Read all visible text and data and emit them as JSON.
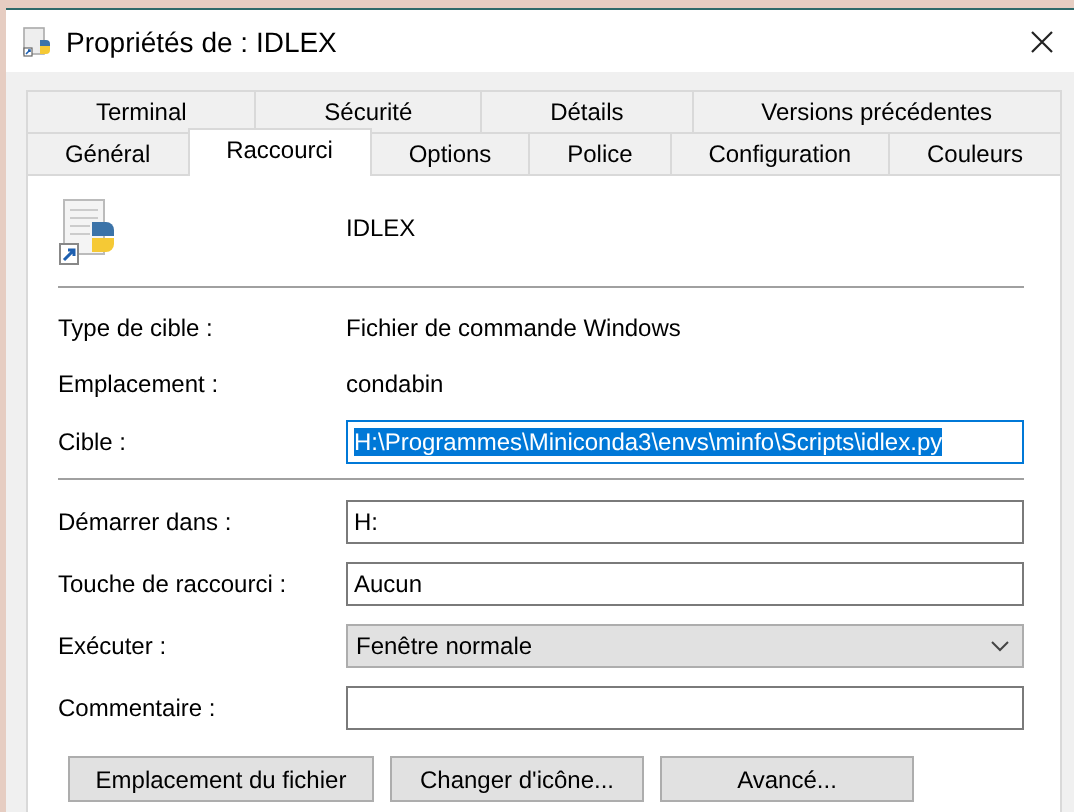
{
  "window": {
    "title": "Propriétés de : IDLEX"
  },
  "tab_rows": [
    [
      {
        "label": "Terminal",
        "selected": false
      },
      {
        "label": "Sécurité",
        "selected": false
      },
      {
        "label": "Détails",
        "selected": false
      },
      {
        "label": "Versions précédentes",
        "selected": false
      }
    ],
    [
      {
        "label": "Général",
        "selected": false
      },
      {
        "label": "Raccourci",
        "selected": true
      },
      {
        "label": "Options",
        "selected": false
      },
      {
        "label": "Police",
        "selected": false
      },
      {
        "label": "Configuration",
        "selected": false
      },
      {
        "label": "Couleurs",
        "selected": false
      }
    ]
  ],
  "shortcut_name": "IDLEX",
  "info": [
    {
      "label": "Type de cible :",
      "value": "Fichier de commande Windows"
    },
    {
      "label": "Emplacement :",
      "value": "condabin"
    }
  ],
  "target": {
    "label": "Cible :",
    "value": "H:\\Programmes\\Miniconda3\\envs\\minfo\\Scripts\\idlex.py",
    "text_selected": true
  },
  "fields": [
    {
      "kind": "text",
      "label": "Démarrer dans :",
      "value": "H:"
    },
    {
      "kind": "text",
      "label": "Touche de raccourci :",
      "value": "Aucun"
    },
    {
      "kind": "select",
      "label": "Exécuter :",
      "value": "Fenêtre normale"
    },
    {
      "kind": "text",
      "label": "Commentaire :"
    }
  ],
  "buttons": [
    "Emplacement du fichier",
    "Changer d'icône...",
    "Avancé..."
  ]
}
